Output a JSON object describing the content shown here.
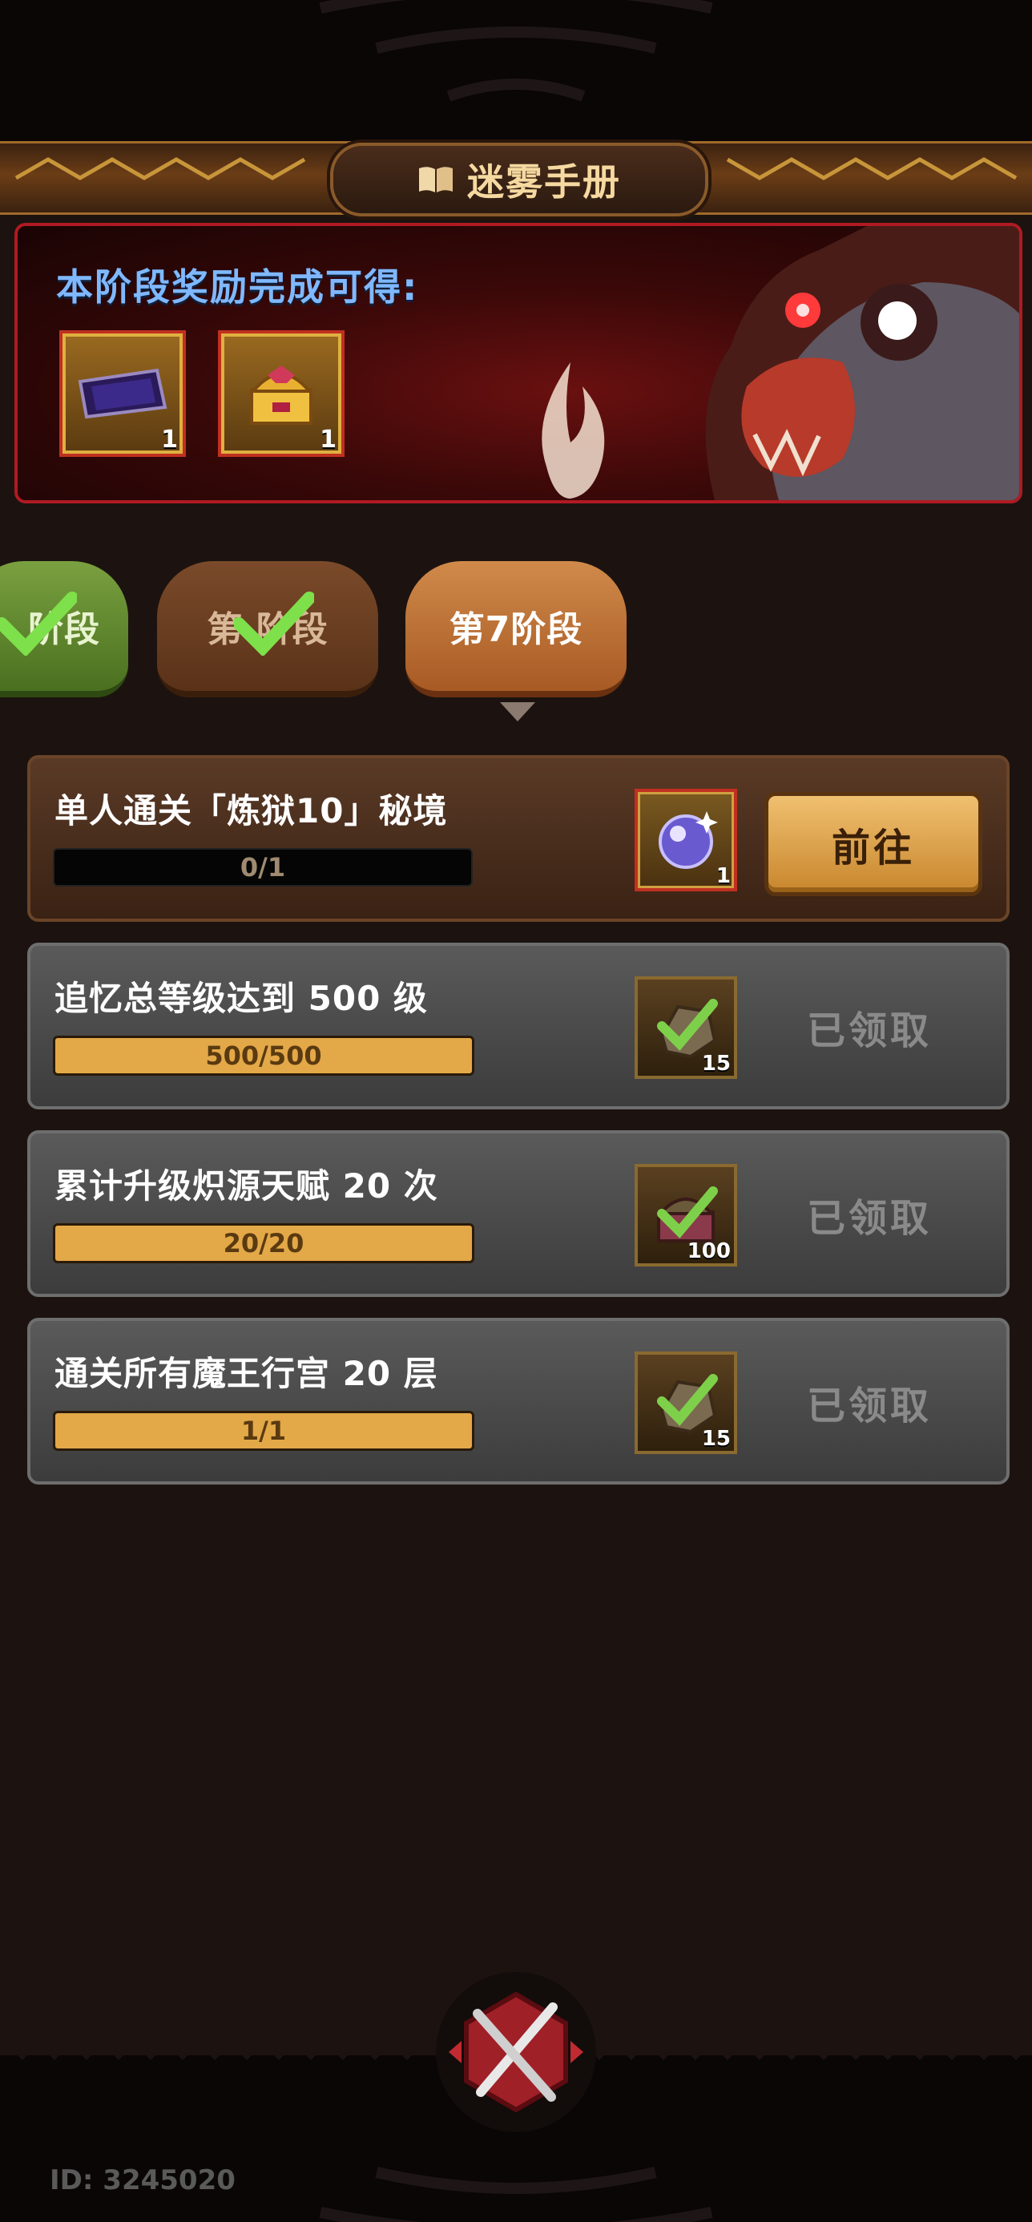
{
  "header": {
    "title": "迷雾手册",
    "icon": "book-icon"
  },
  "hero": {
    "label": "本阶段奖励完成可得:",
    "rewards": [
      {
        "icon": "purple-scroll-icon",
        "count": "1"
      },
      {
        "icon": "golden-chest-icon",
        "count": "1"
      }
    ]
  },
  "stages": [
    {
      "label": "阶段",
      "state": "completed",
      "color": "#5c8a2e"
    },
    {
      "label": "第 阶段",
      "state": "completed",
      "color": "#6a3e22"
    },
    {
      "label": "第7阶段",
      "state": "active",
      "color": "#c07a3a"
    }
  ],
  "tasks": [
    {
      "title": "单人通关「炼狱10」秘境",
      "progress_text": "0/1",
      "progress": 0.0,
      "reward_icon": "crystal-orb-icon",
      "reward_count": "1",
      "action": "前往",
      "state": "active"
    },
    {
      "title": "追忆总等级达到 500 级",
      "progress_text": "500/500",
      "progress": 1.0,
      "reward_icon": "ore-check-icon",
      "reward_count": "15",
      "action": "已领取",
      "state": "claimed"
    },
    {
      "title": "累计升级炽源天赋 20 次",
      "progress_text": "20/20",
      "progress": 1.0,
      "reward_icon": "chest-check-icon",
      "reward_count": "100",
      "action": "已领取",
      "state": "claimed"
    },
    {
      "title": "通关所有魔王行宫 20 层",
      "progress_text": "1/1",
      "progress": 1.0,
      "reward_icon": "ore-check-icon",
      "reward_count": "15",
      "action": "已领取",
      "state": "claimed"
    }
  ],
  "footer": {
    "id_label": "ID: 3245020",
    "close_icon": "crossed-swords-close-icon"
  },
  "colors": {
    "accent": "#e3a848",
    "hero_border": "#b01a22",
    "hero_label": "#7fb8ff",
    "claimed_text": "#8a8a8a"
  }
}
